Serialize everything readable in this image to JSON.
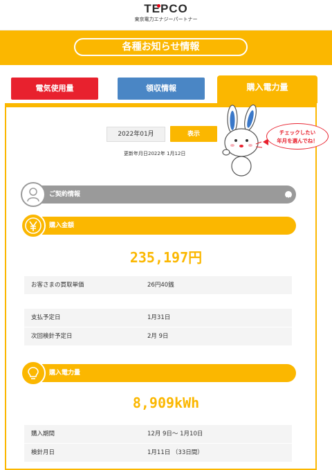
{
  "header": {
    "logo": "TEPCO",
    "logo_sub": "東京電力エナジーパートナー"
  },
  "title_band": {
    "label": "各種お知らせ情報"
  },
  "tabs": [
    {
      "label": "電気使用量"
    },
    {
      "label": "領収情報"
    },
    {
      "label": "購入電力量"
    }
  ],
  "filter": {
    "month": "2022年01月",
    "show_label": "表示",
    "updated": "更新年月日2022年 1月12日"
  },
  "mascot": {
    "bubble_line1": "チェックしたい",
    "bubble_line2": "年月を選んでね！"
  },
  "sections": {
    "contract": {
      "label": "ご契約情報"
    },
    "amount": {
      "label": "購入金額",
      "value": "235,197円",
      "rows": [
        {
          "key": "お客さまの買取単価",
          "value": "26円40銭"
        },
        {
          "key": "支払予定日",
          "value": "1月31日"
        },
        {
          "key": "次回検針予定日",
          "value": "2月 9日"
        }
      ]
    },
    "power": {
      "label": "購入電力量",
      "value": "8,909kWh",
      "rows": [
        {
          "key": "購入期間",
          "value": "12月 9日～ 1月10日"
        },
        {
          "key": "検針月日",
          "value": "1月11日 （33日間）"
        }
      ]
    }
  },
  "colors": {
    "accent": "#fbb700",
    "red": "#e8212e",
    "blue": "#4a86c5",
    "gray": "#9a9a9a"
  }
}
